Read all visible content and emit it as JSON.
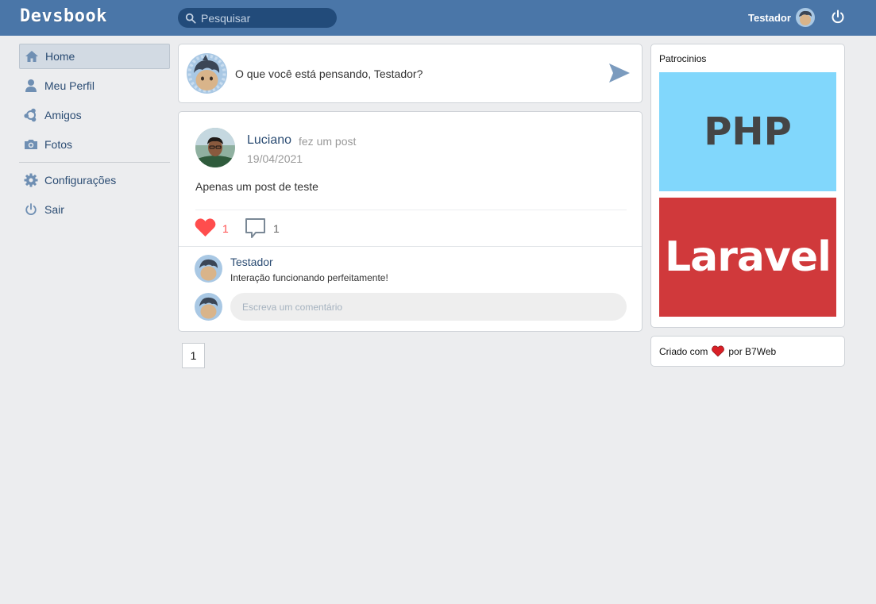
{
  "header": {
    "logo": "Devsbook",
    "search_placeholder": "Pesquisar",
    "user_name": "Testador"
  },
  "sidebar": {
    "items": [
      {
        "label": "Home",
        "icon": "home-icon",
        "active": true
      },
      {
        "label": "Meu Perfil",
        "icon": "user-icon",
        "active": false
      },
      {
        "label": "Amigos",
        "icon": "friends-icon",
        "active": false
      },
      {
        "label": "Fotos",
        "icon": "camera-icon",
        "active": false
      }
    ],
    "bottom_items": [
      {
        "label": "Configurações",
        "icon": "gear-icon"
      },
      {
        "label": "Sair",
        "icon": "power-icon"
      }
    ]
  },
  "composer": {
    "prompt": "O que você está pensando, Testador?"
  },
  "post": {
    "author": "Luciano",
    "action": "fez um post",
    "date": "19/04/2021",
    "body": "Apenas um post de teste",
    "like_count": "1",
    "comment_count": "1",
    "comments": [
      {
        "author": "Testador",
        "text": "Interação funcionando perfeitamente!"
      }
    ],
    "comment_placeholder": "Escreva um comentário"
  },
  "pagination": {
    "current_page": "1"
  },
  "sponsors": {
    "title": "Patrocinios",
    "ads": [
      "PHP",
      "Laravel"
    ]
  },
  "footer": {
    "prefix": "Criado com",
    "suffix": "por B7Web"
  },
  "colors": {
    "header": "#4a76a8",
    "search": "#224b7a",
    "link": "#2b4c73",
    "like": "#ff4d4d",
    "php_ad": "#81d7fc",
    "laravel_ad": "#d0393b",
    "background": "#ecedef"
  }
}
